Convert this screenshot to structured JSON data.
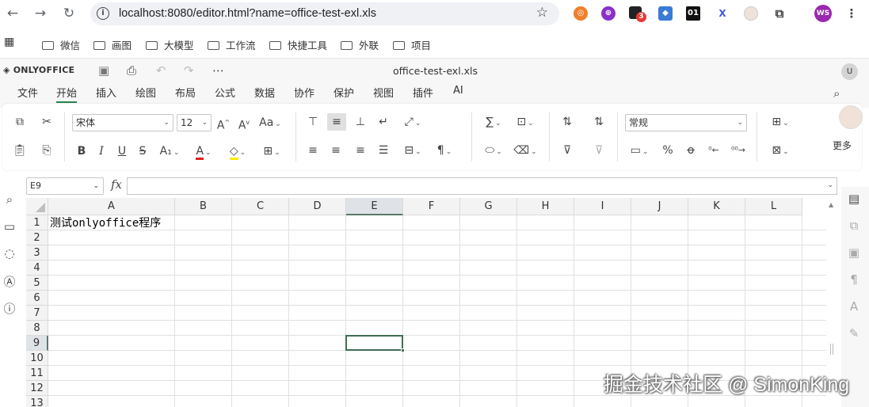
{
  "browser": {
    "url": "localhost:8080/editor.html?name=office-test-exl.xls",
    "bookmarks": [
      "微信",
      "画图",
      "大模型",
      "工作流",
      "快捷工具",
      "外联",
      "项目"
    ],
    "extensions": {
      "badge_count": "3",
      "ext_01": "01",
      "ext_x": "X",
      "profile_initials": "WS"
    }
  },
  "editor": {
    "brand": "ONLYOFFICE",
    "doc_title": "office-test-exl.xls",
    "user_initial": "U",
    "menu_tabs": [
      "文件",
      "开始",
      "插入",
      "绘图",
      "布局",
      "公式",
      "数据",
      "协作",
      "保护",
      "视图",
      "插件",
      "AI"
    ],
    "active_tab": "开始",
    "more_label": "更多"
  },
  "toolbar": {
    "font_name": "宋体",
    "font_size": "12",
    "number_format": "常规",
    "aa_label": "Aa",
    "grow_font": "A",
    "shrink_font": "A",
    "bold": "B",
    "italic": "I",
    "underline": "U",
    "strike": "S",
    "subscript": "A₁",
    "font_color": "A",
    "font_color_bar": "#e02020",
    "fill_color_bar": "#ffea00",
    "percent": "%",
    "sigma": "∑"
  },
  "formula_bar": {
    "name_box": "E9",
    "fx_label": "fx",
    "formula_value": ""
  },
  "sheet": {
    "columns": [
      "A",
      "B",
      "C",
      "D",
      "E",
      "F",
      "G",
      "H",
      "I",
      "J",
      "K",
      "L"
    ],
    "rows": [
      "1",
      "2",
      "3",
      "4",
      "5",
      "6",
      "7",
      "8",
      "9",
      "10",
      "11",
      "12",
      "13"
    ],
    "selected_col": "E",
    "selected_row": "9",
    "cell_a1": "测试onlyoffice程序"
  },
  "watermark": "掘金技术社区 @ SimonKing",
  "colors": {
    "accent": "#28854f",
    "selection": "#3f6e52"
  }
}
